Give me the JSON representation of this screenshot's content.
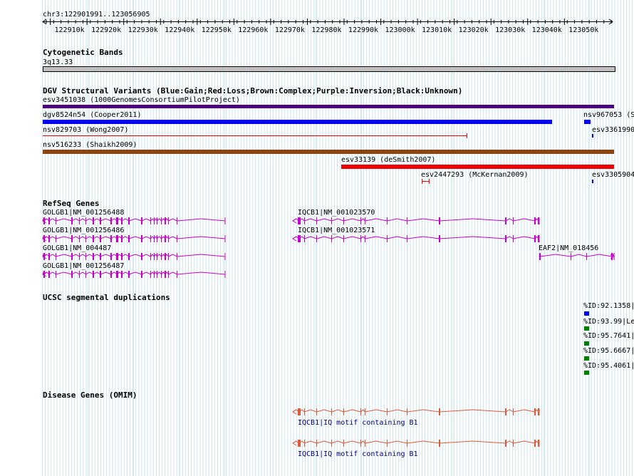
{
  "ruler": {
    "title": "chr3:122901991..123056905",
    "ticks": [
      "122910k",
      "122920k",
      "122930k",
      "122940k",
      "122950k",
      "122960k",
      "122970k",
      "122980k",
      "122990k",
      "123000k",
      "123010k",
      "123020k",
      "123030k",
      "123040k",
      "123050k"
    ]
  },
  "tracks": {
    "cytoband": {
      "title": "Cytogenetic Bands",
      "band": "3q13.33"
    },
    "dgv": {
      "title": "DGV Structural Variants (Blue:Gain;Red:Loss;Brown:Complex;Purple:Inversion;Black:Unknown)",
      "colors": {
        "gain": "#0000ee",
        "loss": "#ee0000",
        "complex": "#8b4513",
        "inversion": "#4b0082"
      },
      "labels": {
        "esv3451038": "esv3451038 (1000GenomesConsortiumPilotProject)",
        "dgv8524n54": "dgv8524n54 (Cooper2011)",
        "nsv967053": "nsv967053 (S",
        "nsv829703": "nsv829703 (Wong2007)",
        "esv3361990": "esv3361990",
        "nsv516233": "nsv516233 (Shaikh2009)",
        "esv33139": "esv33139 (deSmith2007)",
        "esv2447293": "esv2447293 (McKernan2009)",
        "esv3305904": "esv3305904"
      }
    },
    "refseq": {
      "title": "RefSeq Genes",
      "color": "#cc00cc",
      "labels": {
        "golgb1_488": "GOLGB1|NM_001256488",
        "golgb1_486": "GOLGB1|NM_001256486",
        "golgb1_4487": "GOLGB1|NM_004487",
        "golgb1_487": "GOLGB1|NM_001256487",
        "iqcb1_570": "IQCB1|NM_001023570",
        "iqcb1_571": "IQCB1|NM_001023571",
        "eaf2": "EAF2|NM_018456"
      }
    },
    "segdup": {
      "title": "UCSC segmental duplications",
      "labels": [
        "%ID:92.1358|",
        "%ID:93.99|Le",
        "%ID:95.7641|",
        "%ID:95.6667|",
        "%ID:95.4061|"
      ]
    },
    "omim": {
      "title": "Disease Genes (OMIM)",
      "color": "#e05a3a",
      "labels": [
        "IQCB1|IQ motif containing B1",
        "IQCB1|IQ motif containing B1"
      ]
    }
  }
}
